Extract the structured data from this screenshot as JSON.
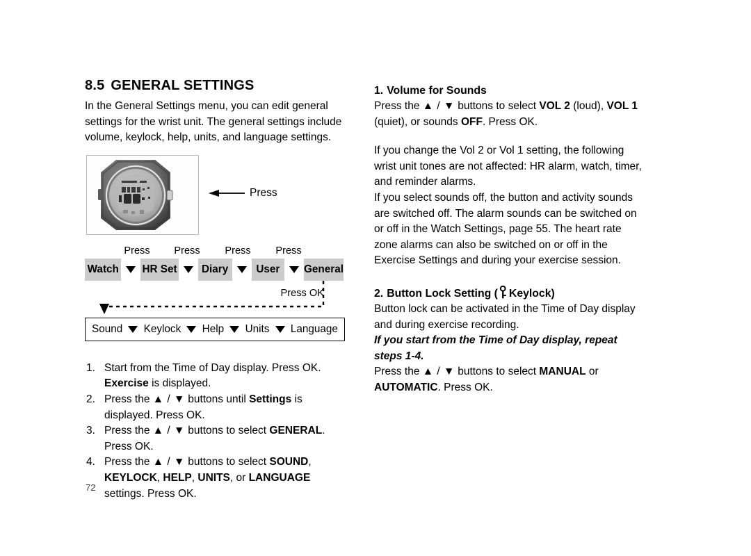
{
  "page": {
    "number": "72"
  },
  "left_column": {
    "section": {
      "number": "8.5",
      "title": "GENERAL SETTINGS"
    },
    "intro": "In the General Settings menu, you can edit general settings for the wrist unit. The general settings include volume, keylock, help, units, and language settings.",
    "figure": {
      "alt": "Wrist unit watch photo",
      "callout_label": "Press"
    },
    "diagram": {
      "press_labels": [
        "Press",
        "Press",
        "Press",
        "Press"
      ],
      "top_menu": [
        "Watch",
        "HR Set",
        "Diary",
        "User",
        "General"
      ],
      "ok_label": "Press OK",
      "sub_menu": [
        "Sound",
        "Keylock",
        "Help",
        "Units",
        "Language"
      ],
      "separator_icon": "triangle-down-icon"
    },
    "steps": [
      {
        "marker": "1.",
        "parts": [
          {
            "t": "Start from the Time of Day display. Press OK. ",
            "b": false
          },
          {
            "t": "Exercise",
            "b": true
          },
          {
            "t": " is displayed.",
            "b": false
          }
        ]
      },
      {
        "marker": "2.",
        "parts": [
          {
            "t": "Press the ",
            "b": false
          },
          {
            "t": "▲ / ▼",
            "b": false
          },
          {
            "t": " buttons until ",
            "b": false
          },
          {
            "t": "Settings",
            "b": true
          },
          {
            "t": " is displayed. Press OK.",
            "b": false
          }
        ]
      },
      {
        "marker": "3.",
        "parts": [
          {
            "t": "Press the ",
            "b": false
          },
          {
            "t": "▲ / ▼",
            "b": false
          },
          {
            "t": " buttons to select ",
            "b": false
          },
          {
            "t": "GENERAL",
            "b": true
          },
          {
            "t": ". Press OK.",
            "b": false
          }
        ]
      },
      {
        "marker": "4.",
        "parts": [
          {
            "t": "Press the ",
            "b": false
          },
          {
            "t": "▲ / ▼",
            "b": false
          },
          {
            "t": " buttons to select ",
            "b": false
          },
          {
            "t": "SOUND",
            "b": true
          },
          {
            "t": ", ",
            "b": false
          },
          {
            "t": "KEYLOCK",
            "b": true
          },
          {
            "t": ", ",
            "b": false
          },
          {
            "t": "HELP",
            "b": true
          },
          {
            "t": ",  ",
            "b": false
          },
          {
            "t": "UNITS",
            "b": true
          },
          {
            "t": ", or ",
            "b": false
          },
          {
            "t": "LANGUAGE",
            "b": true
          },
          {
            "t": " settings. Press OK.",
            "b": false
          }
        ]
      }
    ]
  },
  "right_column": {
    "item1": {
      "heading_number": "1.",
      "heading_text": "Volume for Sounds",
      "instruction_parts": [
        {
          "t": "Press the ",
          "b": false
        },
        {
          "t": "▲ / ▼",
          "b": false
        },
        {
          "t": " buttons to select ",
          "b": false
        },
        {
          "t": "VOL 2",
          "b": true
        },
        {
          "t": " (loud), ",
          "b": false
        },
        {
          "t": "VOL 1",
          "b": true
        },
        {
          "t": " (quiet), or sounds ",
          "b": false
        },
        {
          "t": "OFF",
          "b": true
        },
        {
          "t": ". Press OK.",
          "b": false
        }
      ],
      "paragraph1": "If you change the Vol 2 or Vol 1 setting, the following wrist unit tones are not affected: HR alarm, watch, timer, and reminder alarms.",
      "paragraph2": "If you select sounds off, the button and activity sounds are switched off. The alarm sounds can be switched on or off in the Watch Settings, page 55. The heart rate zone alarms can also be switched on or off in the Exercise Settings and during your exercise session."
    },
    "item2": {
      "heading_number": "2.",
      "heading_before_icon": "Button Lock Setting (",
      "heading_icon": "key-icon",
      "heading_after_icon": "Keylock)",
      "paragraph": "Button lock can be activated in the Time of Day display and during exercise recording.",
      "italic_note": "If you start from the Time of Day display, repeat steps 1-4.",
      "instruction_parts": [
        {
          "t": "Press the ",
          "b": false
        },
        {
          "t": "▲ / ▼",
          "b": false
        },
        {
          "t": " buttons to select ",
          "b": false
        },
        {
          "t": "MANUAL",
          "b": true
        },
        {
          "t": " or ",
          "b": false
        },
        {
          "t": "AUTOMATIC",
          "b": true
        },
        {
          "t": ". Press OK.",
          "b": false
        }
      ]
    }
  },
  "colors": {
    "menu_box": "#cccccc",
    "text": "#000000",
    "page_background": "#ffffff"
  }
}
